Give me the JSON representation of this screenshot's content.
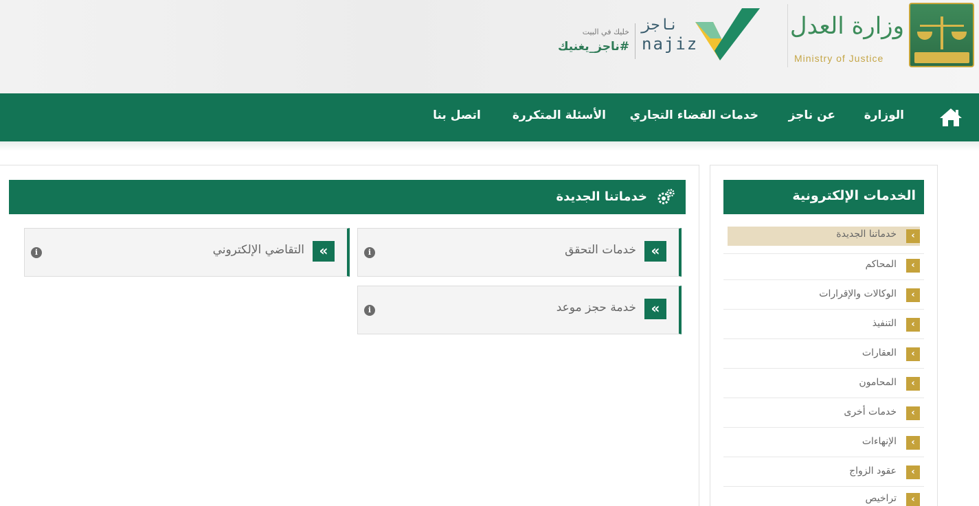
{
  "header": {
    "ministry_name_ar": "وزارة العدل",
    "ministry_name_en": "Ministry of Justice",
    "najiz_logo_ar": "ناجز",
    "najiz_logo_en": "najiz",
    "slogan_top": "خليك في البيت",
    "slogan_main": "#ناجز_يغنيك"
  },
  "nav": {
    "home_icon": "home-icon",
    "items": [
      {
        "label": "الوزارة"
      },
      {
        "label": "عن ناجز"
      },
      {
        "label": "خدمات القضاء التجاري"
      },
      {
        "label": "الأسئلة المتكررة"
      },
      {
        "label": "اتصل بنا"
      }
    ]
  },
  "sidebar": {
    "title": "الخدمات الإلكترونية",
    "items": [
      {
        "label": "خدماتنا الجديدة",
        "active": true
      },
      {
        "label": "المحاكم"
      },
      {
        "label": "الوكالات والإقرارات"
      },
      {
        "label": "التنفيذ"
      },
      {
        "label": "العقارات"
      },
      {
        "label": "المحامون"
      },
      {
        "label": "خدمات أخرى"
      },
      {
        "label": "الإنهاءات"
      },
      {
        "label": "عقود الزواج"
      },
      {
        "label": "تراخيص"
      }
    ]
  },
  "main": {
    "title": "خدماتنا الجديدة",
    "cards": [
      {
        "label": "خدمات التحقق"
      },
      {
        "label": "التقاضي الإلكتروني"
      },
      {
        "label": "خدمة حجز موعد"
      }
    ]
  },
  "colors": {
    "primary_green": "#137455",
    "gold": "#c5a23b",
    "active_bg": "#e8dcc0"
  }
}
